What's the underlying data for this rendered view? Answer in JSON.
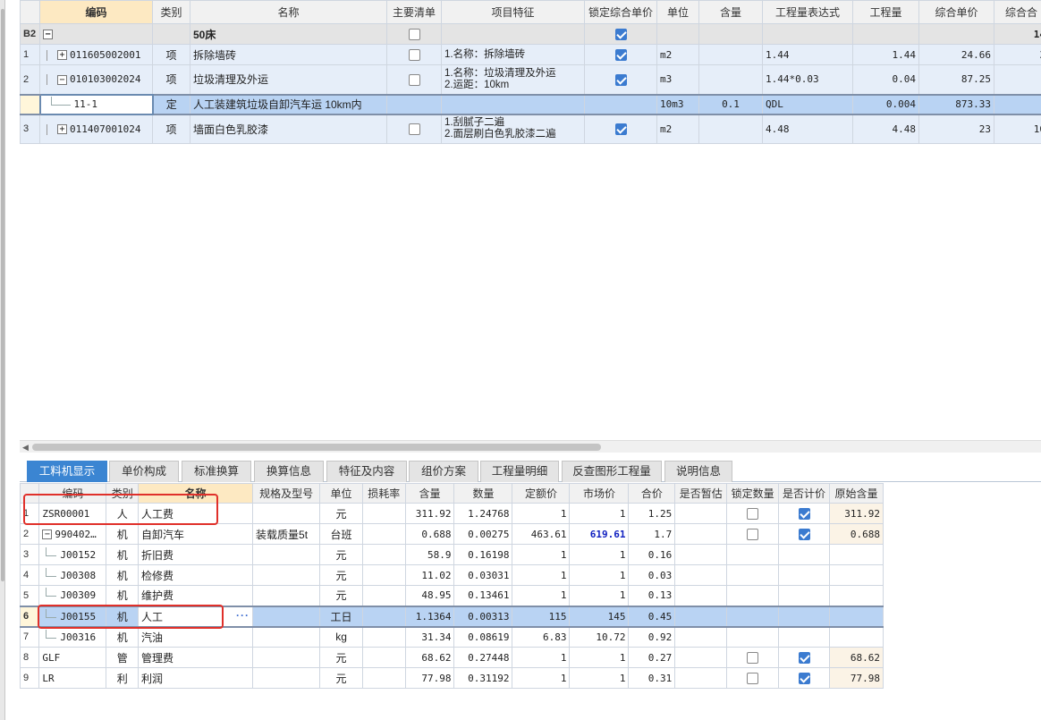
{
  "top_grid": {
    "headers": [
      "编码",
      "类别",
      "名称",
      "主要清单",
      "项目特征",
      "锁定综合单价",
      "单位",
      "含量",
      "工程量表达式",
      "工程量",
      "综合单价",
      "综合合"
    ],
    "group_row": {
      "row_label": "B2",
      "name": "50床",
      "locked": true,
      "total": "14"
    },
    "rows": [
      {
        "rn": "1",
        "code": "011605002001",
        "type": "项",
        "name": "拆除墙砖",
        "main": false,
        "feature_1": "1.名称：拆除墙砖",
        "feature_2": "",
        "locked": true,
        "unit": "m2",
        "content": "",
        "expr": "1.44",
        "qty": "1.44",
        "unit_price": "24.66",
        "total": "3"
      },
      {
        "rn": "2",
        "code": "010103002024",
        "type": "项",
        "name": "垃圾清理及外运",
        "main": false,
        "feature_1": "1.名称：垃圾清理及外运",
        "feature_2": "2.运距：10km",
        "locked": true,
        "unit": "m3",
        "content": "",
        "expr": "1.44*0.03",
        "qty": "0.04",
        "unit_price": "87.25",
        "total": ""
      },
      {
        "rn": "",
        "code": "11-1",
        "type": "定",
        "name": "人工装建筑垃圾自卸汽车运 10km内",
        "unit": "10m3",
        "content": "0.1",
        "expr": "QDL",
        "qty": "0.004",
        "unit_price": "873.33",
        "total": ""
      },
      {
        "rn": "3",
        "code": "011407001024",
        "type": "项",
        "name": "墙面白色乳胶漆",
        "main": false,
        "feature_1": "1.刮腻子二遍",
        "feature_2": "2.面层刷白色乳胶漆二遍",
        "locked": true,
        "unit": "m2",
        "content": "",
        "expr": "4.48",
        "qty": "4.48",
        "unit_price": "23",
        "total": "10"
      }
    ]
  },
  "tabs": [
    "工料机显示",
    "单价构成",
    "标准换算",
    "换算信息",
    "特征及内容",
    "组价方案",
    "工程量明细",
    "反查图形工程量",
    "说明信息"
  ],
  "bottom_grid": {
    "headers": [
      "编码",
      "类别",
      "名称",
      "规格及型号",
      "单位",
      "损耗率",
      "含量",
      "数量",
      "定额价",
      "市场价",
      "合价",
      "是否暂估",
      "锁定数量",
      "是否计价",
      "原始含量"
    ],
    "rows": [
      {
        "rn": "1",
        "code": "ZSR00001",
        "type": "人",
        "name": "人工费",
        "spec": "",
        "unit": "元",
        "loss": "",
        "content": "311.92",
        "qty": "1.24768",
        "quota": "1",
        "market": "1",
        "total": "1.25",
        "lock": false,
        "price": true,
        "orig": "311.92"
      },
      {
        "rn": "2",
        "code": "990402…",
        "type": "机",
        "name": "自卸汽车",
        "spec": "装载质量5t",
        "unit": "台班",
        "loss": "",
        "content": "0.688",
        "qty": "0.00275",
        "quota": "463.61",
        "market": "619.61",
        "total": "1.7",
        "lock": false,
        "price": true,
        "orig": "0.688"
      },
      {
        "rn": "3",
        "code": "J00152",
        "type": "机",
        "name": "折旧费",
        "spec": "",
        "unit": "元",
        "loss": "",
        "content": "58.9",
        "qty": "0.16198",
        "quota": "1",
        "market": "1",
        "total": "0.16"
      },
      {
        "rn": "4",
        "code": "J00308",
        "type": "机",
        "name": "检修费",
        "spec": "",
        "unit": "元",
        "loss": "",
        "content": "11.02",
        "qty": "0.03031",
        "quota": "1",
        "market": "1",
        "total": "0.03"
      },
      {
        "rn": "5",
        "code": "J00309",
        "type": "机",
        "name": "维护费",
        "spec": "",
        "unit": "元",
        "loss": "",
        "content": "48.95",
        "qty": "0.13461",
        "quota": "1",
        "market": "1",
        "total": "0.13"
      },
      {
        "rn": "6",
        "code": "J00155",
        "type": "机",
        "name": "人工",
        "spec": "",
        "unit": "工日",
        "loss": "",
        "content": "1.1364",
        "qty": "0.00313",
        "quota": "115",
        "market": "145",
        "total": "0.45"
      },
      {
        "rn": "7",
        "code": "J00316",
        "type": "机",
        "name": "汽油",
        "spec": "",
        "unit": "kg",
        "loss": "",
        "content": "31.34",
        "qty": "0.08619",
        "quota": "6.83",
        "market": "10.72",
        "total": "0.92"
      },
      {
        "rn": "8",
        "code": "GLF",
        "type": "管",
        "name": "管理费",
        "spec": "",
        "unit": "元",
        "loss": "",
        "content": "68.62",
        "qty": "0.27448",
        "quota": "1",
        "market": "1",
        "total": "0.27",
        "lock": false,
        "price": true,
        "orig": "68.62"
      },
      {
        "rn": "9",
        "code": "LR",
        "type": "利",
        "name": "利润",
        "spec": "",
        "unit": "元",
        "loss": "",
        "content": "77.98",
        "qty": "0.31192",
        "quota": "1",
        "market": "1",
        "total": "0.31",
        "lock": false,
        "price": true,
        "orig": "77.98"
      }
    ],
    "ellipsis": "···"
  },
  "colors": {
    "accent_tab": "#3b85d2",
    "selection": "#b9d3f3",
    "annotation": "#e0302a",
    "market_price_highlight": "#1020c0"
  }
}
